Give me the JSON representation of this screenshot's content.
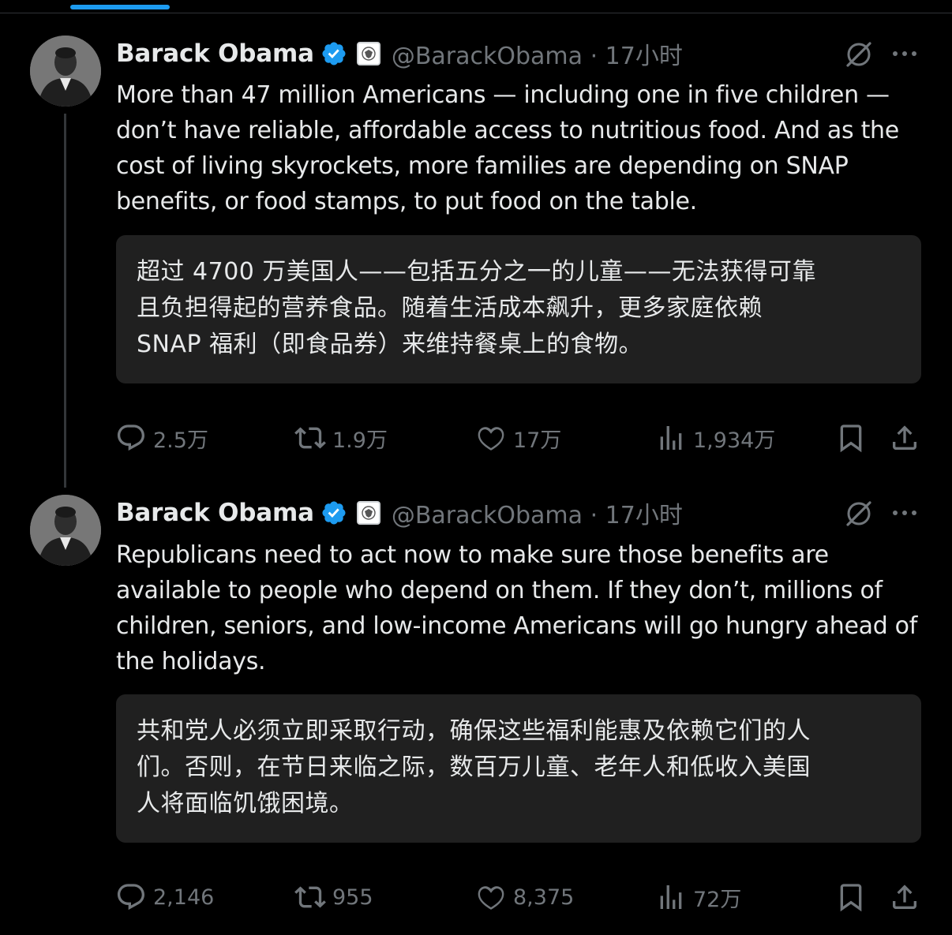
{
  "tweets": [
    {
      "display_name": "Barack Obama",
      "handle": "@BarackObama",
      "time": "17小时",
      "text": "More than 47 million Americans — including one in five children — don’t have reliable, affordable access to nutritious food. And as the cost of living skyrockets, more families are depending on SNAP benefits, or food stamps, to put food on the table.",
      "translation_lines": [
        "超过 4700 万美国人——包括五分之一的儿童——无法获得可靠",
        "且负担得起的营养食品。随着生活成本飙升，更多家庭依赖",
        "SNAP 福利（即食品券）来维持餐桌上的食物。"
      ],
      "replies": "2.5万",
      "reposts": "1.9万",
      "likes": "17万",
      "views": "1,934万"
    },
    {
      "display_name": "Barack Obama",
      "handle": "@BarackObama",
      "time": "17小时",
      "text": "Republicans need to act now to make sure those benefits are available to people who depend on them. If they don’t, millions of children, seniors, and low-income Americans will go hungry ahead of the holidays.",
      "translation_lines": [
        "共和党人必须立即采取行动，确保这些福利能惠及依赖它们的人",
        "们。否则，在节日来临之际，数百万儿童、老年人和低收入美国",
        "人将面临饥饿困境。"
      ],
      "replies": "2,146",
      "reposts": "955",
      "likes": "8,375",
      "views": "72万"
    }
  ],
  "colors": {
    "background": "#000000",
    "text": "#e7e9ea",
    "secondary": "#71767b",
    "accent": "#1d9bf0",
    "translation_bg": "#202020"
  },
  "icons": [
    "verified-badge-icon",
    "government-seal-icon",
    "grok-icon",
    "more-icon",
    "reply-icon",
    "repost-icon",
    "like-icon",
    "views-icon",
    "bookmark-icon",
    "share-icon"
  ]
}
